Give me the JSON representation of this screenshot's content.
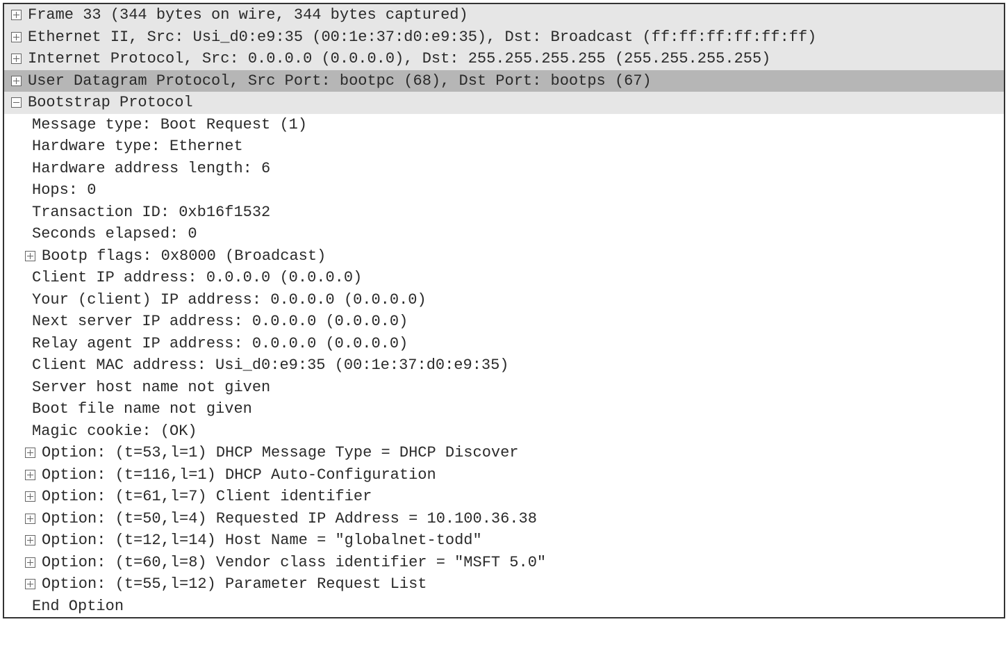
{
  "layers": {
    "frame": "Frame 33 (344 bytes on wire, 344 bytes captured)",
    "eth": "Ethernet II, Src: Usi_d0:e9:35 (00:1e:37:d0:e9:35), Dst: Broadcast (ff:ff:ff:ff:ff:ff)",
    "ip": "Internet Protocol, Src: 0.0.0.0 (0.0.0.0), Dst: 255.255.255.255 (255.255.255.255)",
    "udp": "User Datagram Protocol, Src Port: bootpc (68), Dst Port: bootps (67)",
    "bootp": "Bootstrap Protocol"
  },
  "fields": {
    "msgtype": "Message type: Boot Request (1)",
    "hwtype": "Hardware type: Ethernet",
    "hwlen": "Hardware address length: 6",
    "hops": "Hops: 0",
    "xid": "Transaction ID: 0xb16f1532",
    "secs": "Seconds elapsed: 0",
    "flags": "Bootp flags: 0x8000 (Broadcast)",
    "ciaddr": "Client IP address: 0.0.0.0 (0.0.0.0)",
    "yiaddr": "Your (client) IP address: 0.0.0.0 (0.0.0.0)",
    "siaddr": "Next server IP address: 0.0.0.0 (0.0.0.0)",
    "giaddr": "Relay agent IP address: 0.0.0.0 (0.0.0.0)",
    "chaddr": "Client MAC address: Usi_d0:e9:35 (00:1e:37:d0:e9:35)",
    "sname": "Server host name not given",
    "file": "Boot file name not given",
    "cookie": "Magic cookie: (OK)",
    "opt53": "Option: (t=53,l=1) DHCP Message Type = DHCP Discover",
    "opt116": "Option: (t=116,l=1) DHCP Auto-Configuration",
    "opt61": "Option: (t=61,l=7) Client identifier",
    "opt50": "Option: (t=50,l=4) Requested IP Address = 10.100.36.38",
    "opt12": "Option: (t=12,l=14) Host Name = \"globalnet-todd\"",
    "opt60": "Option: (t=60,l=8) Vendor class identifier = \"MSFT 5.0\"",
    "opt55": "Option: (t=55,l=12) Parameter Request List",
    "end": "End Option"
  }
}
